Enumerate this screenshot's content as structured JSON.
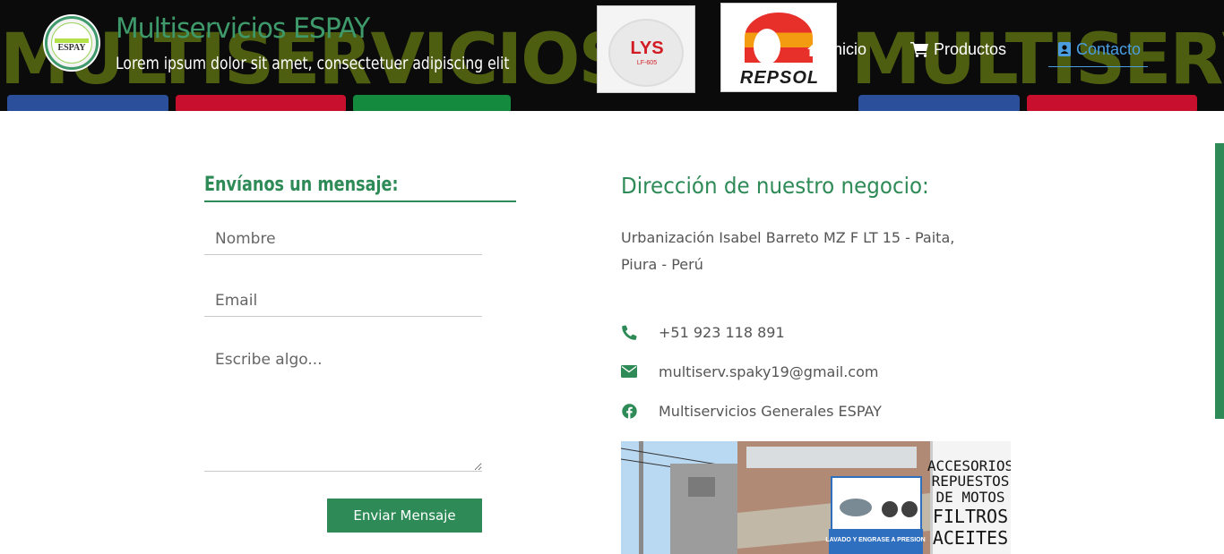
{
  "header": {
    "site_title": "Multiservicios ESPAY",
    "tagline": "Lorem ipsum dolor sit amet, consectetuer adipiscing elit",
    "logo_text": "ESPAY",
    "banner_word": "MULTISERVICIOS",
    "banner_word_right": "MULTISERV",
    "brand_lys": "LYS",
    "brand_lys_sub": "LF-605",
    "brand_repsol": "REPSOL",
    "nav": [
      {
        "label": "Inicio",
        "icon": "home-icon"
      },
      {
        "label": "Productos",
        "icon": "cart-icon"
      },
      {
        "label": "Contacto",
        "icon": "contact-card-icon",
        "active": true
      }
    ]
  },
  "form": {
    "heading": "Envíanos un mensaje:",
    "name_placeholder": "Nombre",
    "email_placeholder": "Email",
    "message_placeholder": "Escribe algo...",
    "submit_label": "Enviar Mensaje"
  },
  "address": {
    "heading": "Dirección de nuestro negocio:",
    "line1": "Urbanización Isabel Barreto MZ F LT 15 - Paita,",
    "line2": "Piura - Perú"
  },
  "contacts": {
    "phone": "+51 923 118 891",
    "email": "multiserv.spaky19@gmail.com",
    "facebook": "Multiservicios Generales ESPAY"
  },
  "store_sign": {
    "lines": [
      "ACCESORIOS",
      "REPUESTOS",
      "DE MOTOS",
      "FILTROS",
      "ACEITES"
    ],
    "banner": "LAVADO Y ENGRASE A PRESION"
  },
  "colors": {
    "accent_green": "#2e8b57",
    "nav_active_blue": "#4a9ee0",
    "header_bg": "#0b0b0b"
  }
}
